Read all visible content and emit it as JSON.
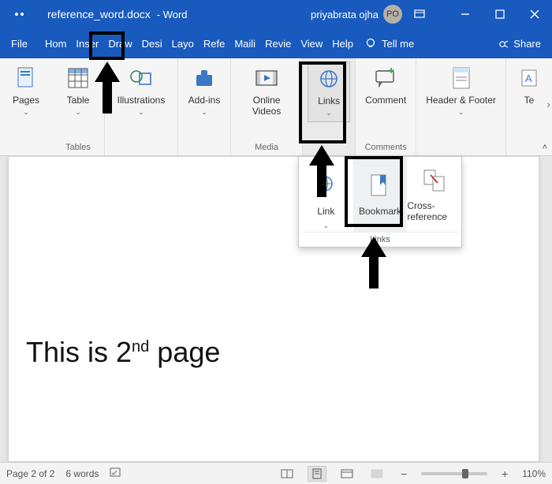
{
  "title": {
    "filename": "reference_word.docx",
    "app": "Word",
    "user": "priyabrata ojha",
    "initials": "PO"
  },
  "tabs": [
    "File",
    "Home",
    "Insert",
    "Draw",
    "Design",
    "Layout",
    "References",
    "Mailings",
    "Review",
    "View",
    "Help"
  ],
  "tabs_short": [
    "File",
    "Hom",
    "Inser",
    "Draw",
    "Desi",
    "Layo",
    "Refe",
    "Maili",
    "Revie",
    "View",
    "Help"
  ],
  "tellme": "Tell me",
  "share": "Share",
  "ribbon": {
    "pages": "Pages",
    "table": "Table",
    "illustrations": "Illustrations",
    "addins": "Add-ins",
    "onlinevideos": "Online Videos",
    "links": "Links",
    "comment": "Comment",
    "headerfooter": "Header & Footer",
    "text": "Te",
    "group_tables": "Tables",
    "group_media": "Media",
    "group_comments": "Comments"
  },
  "links_menu": {
    "link": "Link",
    "bookmark": "Bookmark",
    "crossref": "Cross-reference",
    "footer": "Links"
  },
  "document": {
    "line_pre": "This is 2",
    "line_sup": "nd",
    "line_post": " page"
  },
  "status": {
    "page": "Page 2 of 2",
    "words": "6 words",
    "zoom": "110%"
  }
}
